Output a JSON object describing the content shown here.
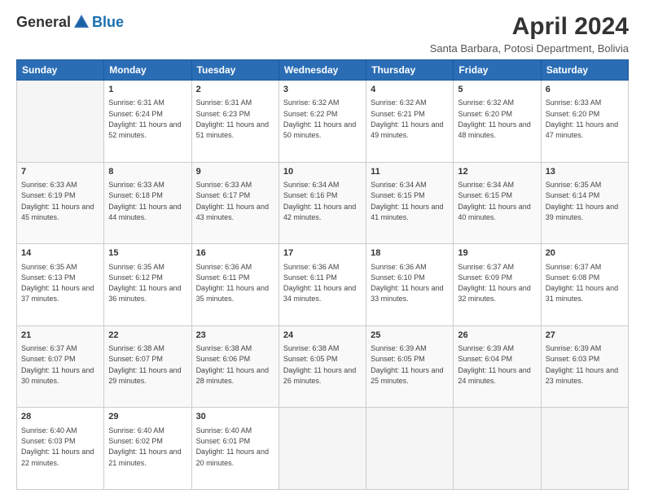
{
  "logo": {
    "general": "General",
    "blue": "Blue"
  },
  "header": {
    "title": "April 2024",
    "subtitle": "Santa Barbara, Potosi Department, Bolivia"
  },
  "days_of_week": [
    "Sunday",
    "Monday",
    "Tuesday",
    "Wednesday",
    "Thursday",
    "Friday",
    "Saturday"
  ],
  "weeks": [
    [
      {
        "day": "",
        "sunrise": "",
        "sunset": "",
        "daylight": ""
      },
      {
        "day": "1",
        "sunrise": "Sunrise: 6:31 AM",
        "sunset": "Sunset: 6:24 PM",
        "daylight": "Daylight: 11 hours and 52 minutes."
      },
      {
        "day": "2",
        "sunrise": "Sunrise: 6:31 AM",
        "sunset": "Sunset: 6:23 PM",
        "daylight": "Daylight: 11 hours and 51 minutes."
      },
      {
        "day": "3",
        "sunrise": "Sunrise: 6:32 AM",
        "sunset": "Sunset: 6:22 PM",
        "daylight": "Daylight: 11 hours and 50 minutes."
      },
      {
        "day": "4",
        "sunrise": "Sunrise: 6:32 AM",
        "sunset": "Sunset: 6:21 PM",
        "daylight": "Daylight: 11 hours and 49 minutes."
      },
      {
        "day": "5",
        "sunrise": "Sunrise: 6:32 AM",
        "sunset": "Sunset: 6:20 PM",
        "daylight": "Daylight: 11 hours and 48 minutes."
      },
      {
        "day": "6",
        "sunrise": "Sunrise: 6:33 AM",
        "sunset": "Sunset: 6:20 PM",
        "daylight": "Daylight: 11 hours and 47 minutes."
      }
    ],
    [
      {
        "day": "7",
        "sunrise": "Sunrise: 6:33 AM",
        "sunset": "Sunset: 6:19 PM",
        "daylight": "Daylight: 11 hours and 45 minutes."
      },
      {
        "day": "8",
        "sunrise": "Sunrise: 6:33 AM",
        "sunset": "Sunset: 6:18 PM",
        "daylight": "Daylight: 11 hours and 44 minutes."
      },
      {
        "day": "9",
        "sunrise": "Sunrise: 6:33 AM",
        "sunset": "Sunset: 6:17 PM",
        "daylight": "Daylight: 11 hours and 43 minutes."
      },
      {
        "day": "10",
        "sunrise": "Sunrise: 6:34 AM",
        "sunset": "Sunset: 6:16 PM",
        "daylight": "Daylight: 11 hours and 42 minutes."
      },
      {
        "day": "11",
        "sunrise": "Sunrise: 6:34 AM",
        "sunset": "Sunset: 6:15 PM",
        "daylight": "Daylight: 11 hours and 41 minutes."
      },
      {
        "day": "12",
        "sunrise": "Sunrise: 6:34 AM",
        "sunset": "Sunset: 6:15 PM",
        "daylight": "Daylight: 11 hours and 40 minutes."
      },
      {
        "day": "13",
        "sunrise": "Sunrise: 6:35 AM",
        "sunset": "Sunset: 6:14 PM",
        "daylight": "Daylight: 11 hours and 39 minutes."
      }
    ],
    [
      {
        "day": "14",
        "sunrise": "Sunrise: 6:35 AM",
        "sunset": "Sunset: 6:13 PM",
        "daylight": "Daylight: 11 hours and 37 minutes."
      },
      {
        "day": "15",
        "sunrise": "Sunrise: 6:35 AM",
        "sunset": "Sunset: 6:12 PM",
        "daylight": "Daylight: 11 hours and 36 minutes."
      },
      {
        "day": "16",
        "sunrise": "Sunrise: 6:36 AM",
        "sunset": "Sunset: 6:11 PM",
        "daylight": "Daylight: 11 hours and 35 minutes."
      },
      {
        "day": "17",
        "sunrise": "Sunrise: 6:36 AM",
        "sunset": "Sunset: 6:11 PM",
        "daylight": "Daylight: 11 hours and 34 minutes."
      },
      {
        "day": "18",
        "sunrise": "Sunrise: 6:36 AM",
        "sunset": "Sunset: 6:10 PM",
        "daylight": "Daylight: 11 hours and 33 minutes."
      },
      {
        "day": "19",
        "sunrise": "Sunrise: 6:37 AM",
        "sunset": "Sunset: 6:09 PM",
        "daylight": "Daylight: 11 hours and 32 minutes."
      },
      {
        "day": "20",
        "sunrise": "Sunrise: 6:37 AM",
        "sunset": "Sunset: 6:08 PM",
        "daylight": "Daylight: 11 hours and 31 minutes."
      }
    ],
    [
      {
        "day": "21",
        "sunrise": "Sunrise: 6:37 AM",
        "sunset": "Sunset: 6:07 PM",
        "daylight": "Daylight: 11 hours and 30 minutes."
      },
      {
        "day": "22",
        "sunrise": "Sunrise: 6:38 AM",
        "sunset": "Sunset: 6:07 PM",
        "daylight": "Daylight: 11 hours and 29 minutes."
      },
      {
        "day": "23",
        "sunrise": "Sunrise: 6:38 AM",
        "sunset": "Sunset: 6:06 PM",
        "daylight": "Daylight: 11 hours and 28 minutes."
      },
      {
        "day": "24",
        "sunrise": "Sunrise: 6:38 AM",
        "sunset": "Sunset: 6:05 PM",
        "daylight": "Daylight: 11 hours and 26 minutes."
      },
      {
        "day": "25",
        "sunrise": "Sunrise: 6:39 AM",
        "sunset": "Sunset: 6:05 PM",
        "daylight": "Daylight: 11 hours and 25 minutes."
      },
      {
        "day": "26",
        "sunrise": "Sunrise: 6:39 AM",
        "sunset": "Sunset: 6:04 PM",
        "daylight": "Daylight: 11 hours and 24 minutes."
      },
      {
        "day": "27",
        "sunrise": "Sunrise: 6:39 AM",
        "sunset": "Sunset: 6:03 PM",
        "daylight": "Daylight: 11 hours and 23 minutes."
      }
    ],
    [
      {
        "day": "28",
        "sunrise": "Sunrise: 6:40 AM",
        "sunset": "Sunset: 6:03 PM",
        "daylight": "Daylight: 11 hours and 22 minutes."
      },
      {
        "day": "29",
        "sunrise": "Sunrise: 6:40 AM",
        "sunset": "Sunset: 6:02 PM",
        "daylight": "Daylight: 11 hours and 21 minutes."
      },
      {
        "day": "30",
        "sunrise": "Sunrise: 6:40 AM",
        "sunset": "Sunset: 6:01 PM",
        "daylight": "Daylight: 11 hours and 20 minutes."
      },
      {
        "day": "",
        "sunrise": "",
        "sunset": "",
        "daylight": ""
      },
      {
        "day": "",
        "sunrise": "",
        "sunset": "",
        "daylight": ""
      },
      {
        "day": "",
        "sunrise": "",
        "sunset": "",
        "daylight": ""
      },
      {
        "day": "",
        "sunrise": "",
        "sunset": "",
        "daylight": ""
      }
    ]
  ]
}
